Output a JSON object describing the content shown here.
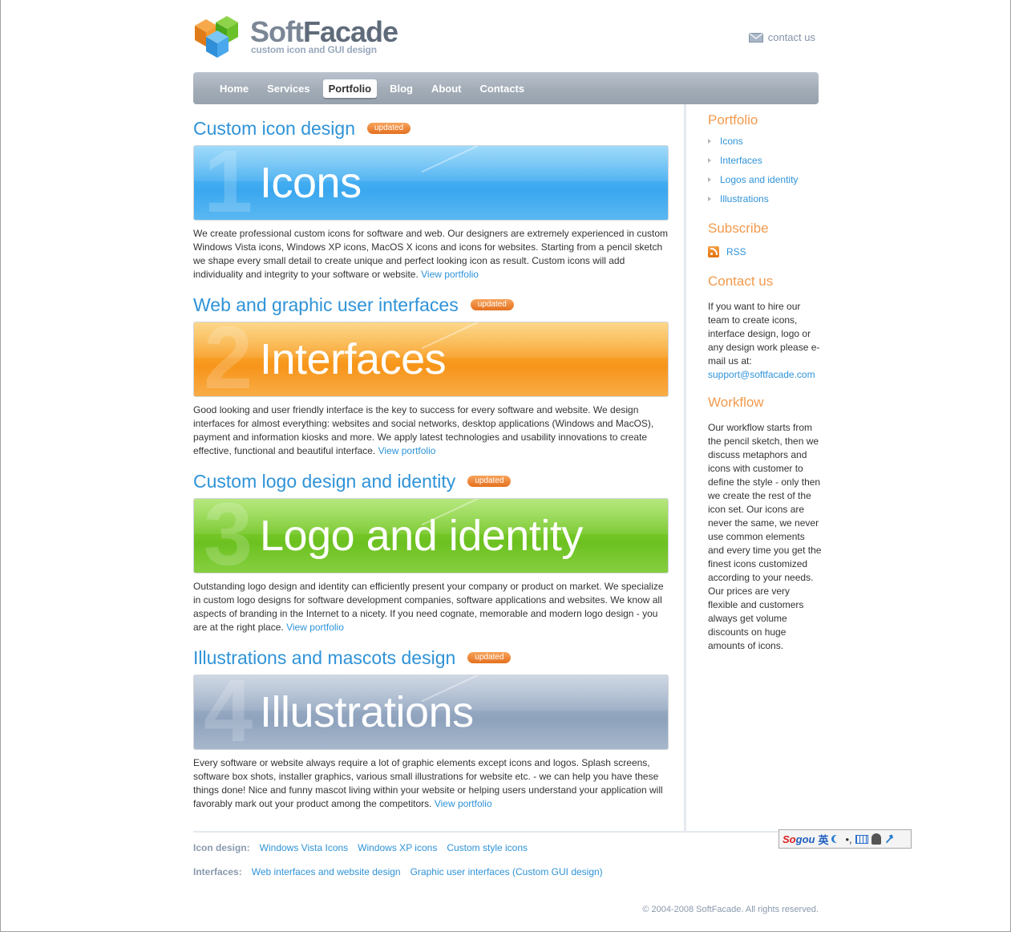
{
  "header": {
    "brand_part1": "Soft",
    "brand_part2": "Facade",
    "tagline": "custom icon and GUI design",
    "contact_label": "contact us"
  },
  "nav": {
    "items": [
      "Home",
      "Services",
      "Portfolio",
      "Blog",
      "About",
      "Contacts"
    ],
    "active": "Portfolio"
  },
  "sections": [
    {
      "heading": "Custom icon design",
      "badge": "updated",
      "banner_number": "1",
      "banner_title": "Icons",
      "text": "We create professional custom icons for software and web. Our designers are extremely experienced in custom Windows Vista icons, Windows XP icons, MacOS X icons and icons for websites. Starting from a pencil sketch we shape every small detail to create unique and perfect looking icon as result. Custom icons will add individuality and integrity to your software or website. ",
      "link": "View portfolio",
      "banner_color": "#3aa7ef"
    },
    {
      "heading": "Web and graphic user interfaces",
      "badge": "updated",
      "banner_number": "2",
      "banner_title": "Interfaces",
      "text": "Good looking and user friendly interface is the key to success for every software and website. We design interfaces for almost everything: websites and social networks, desktop applications (Windows and MacOS), payment and information kiosks and more. We apply latest technologies and usability innovations to create effective, functional and beautiful interface. ",
      "link": "View portfolio",
      "banner_color": "#f7951a"
    },
    {
      "heading": "Custom logo design and identity",
      "badge": "updated",
      "banner_number": "3",
      "banner_title": "Logo and identity",
      "text": "Outstanding logo design and identity can efficiently present your company or product on market. We specialize in custom logo designs for software development companies, software applications and websites. We know all aspects of branding in the Internet to a nicety. If you need cognate, memorable and modern logo design - you are at the right place. ",
      "link": "View portfolio",
      "banner_color": "#6cc120"
    },
    {
      "heading": "Illustrations and mascots design",
      "badge": "updated",
      "banner_number": "4",
      "banner_title": "Illustrations",
      "text": "Every software or website always require a lot of graphic elements except icons and logos. Splash screens, software box shots, installer graphics, various small illustrations for website etc. - we can help you have these things done! Nice and funny mascot living within your website or helping users understand your application will favorably mark out your product among the competitors. ",
      "link": "View portfolio",
      "banner_color": "#8ea2bd"
    }
  ],
  "sidebar": {
    "portfolio": {
      "title": "Portfolio",
      "items": [
        "Icons",
        "Interfaces",
        "Logos and identity",
        "Illustrations"
      ]
    },
    "subscribe": {
      "title": "Subscribe",
      "rss_label": "RSS"
    },
    "contact": {
      "title": "Contact us",
      "text": "If you want to hire our team to create icons, interface design, logo or any design work please e-mail us at:",
      "email": "support@softfacade.com"
    },
    "workflow": {
      "title": "Workflow",
      "text": "Our workflow starts from the pencil sketch, then we discuss metaphors and icons with customer to define the style - only then we create the rest of the icon set. Our icons are never the same, we never use common elements and every time you get the finest icons customized according to your needs. Our prices are very flexible and customers always get volume discounts on huge amounts of icons."
    }
  },
  "footer": {
    "icon_design": {
      "label": "Icon design:",
      "links": [
        "Windows Vista Icons",
        "Windows XP icons",
        "Custom style icons"
      ]
    },
    "interfaces": {
      "label": "Interfaces:",
      "links": [
        "Web interfaces and website design",
        "Graphic user interfaces (Custom GUI design)"
      ]
    },
    "copyright": "© 2004-2008 SoftFacade. All rights reserved."
  },
  "ime_toolbar": {
    "logo_part1": "So",
    "logo_part2": "gou",
    "mode": "英",
    "punct": "•,"
  },
  "colors": {
    "link": "#2f93d8",
    "sidebar_heading": "#f39a4d",
    "badge": "#e4701f",
    "nav_bg": "#a2acb7"
  }
}
